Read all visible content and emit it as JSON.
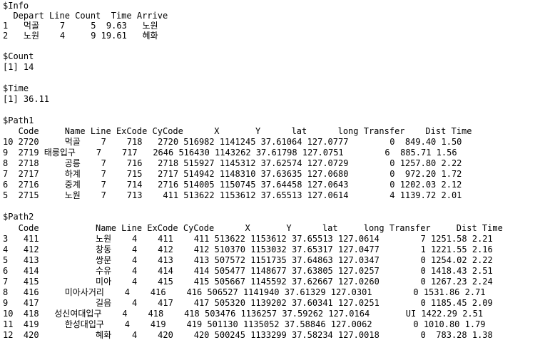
{
  "console": {
    "lines": [
      "$Info",
      "  Depart Line Count  Time Arrive",
      "1   먹골    7     5  9.63   노원",
      "2   노원    4     9 19.61   혜화",
      "",
      "$Count",
      "[1] 14",
      "",
      "$Time",
      "[1] 36.11",
      "",
      "$Path1",
      "   Code     Name Line ExCode CyCode      X       Y      lat      long Transfer    Dist Time",
      "10 2720     먹골    7    718   2720 516982 1141245 37.61064 127.0777        0  849.40 1.50",
      "9  2719 태릉입구    7    717   2646 516430 1143262 37.61798 127.0751        6  885.71 1.56",
      "8  2718     공릉    7    716   2718 515927 1145312 37.62574 127.0729        0 1257.80 2.22",
      "7  2717     하계    7    715   2717 514942 1148310 37.63635 127.0680        0  972.20 1.72",
      "6  2716     중계    7    714   2716 514005 1150745 37.64458 127.0643        0 1202.03 2.12",
      "5  2715     노원    7    713    411 513622 1153612 37.65513 127.0614        4 1139.72 2.01",
      "",
      "$Path2",
      "   Code           Name Line ExCode CyCode      X       Y      lat     long Transfer     Dist Time",
      "3   411           노원    4    411    411 513622 1153612 37.65513 127.0614        7 1251.58 2.21",
      "4   412           창동    4    412    412 510370 1153032 37.65317 127.0477        1 1221.55 2.16",
      "5   413           쌍문    4    413    413 507572 1151735 37.64863 127.0347        0 1254.02 2.22",
      "6   414           수유    4    414    414 505477 1148677 37.63805 127.0257        0 1418.43 2.51",
      "7   415           미아    4    415    415 505667 1145592 37.62667 127.0260        0 1267.23 2.24",
      "8   416     미아사거리    4    416    416 506527 1141940 37.61329 127.0301        0 1531.86 2.71",
      "9   417           길음    4    417    417 505320 1139202 37.60341 127.0251        0 1185.45 2.09",
      "10  418   성신여대입구    4    418    418 503476 1136257 37.59262 127.0164       UI 1422.29 2.51",
      "11  419     한성대입구    4    419    419 501130 1135052 37.58846 127.0062        0 1010.80 1.79",
      "12  420           혜화    4    420    420 500245 1133299 37.58234 127.0018        0  783.28 1.38"
    ]
  }
}
